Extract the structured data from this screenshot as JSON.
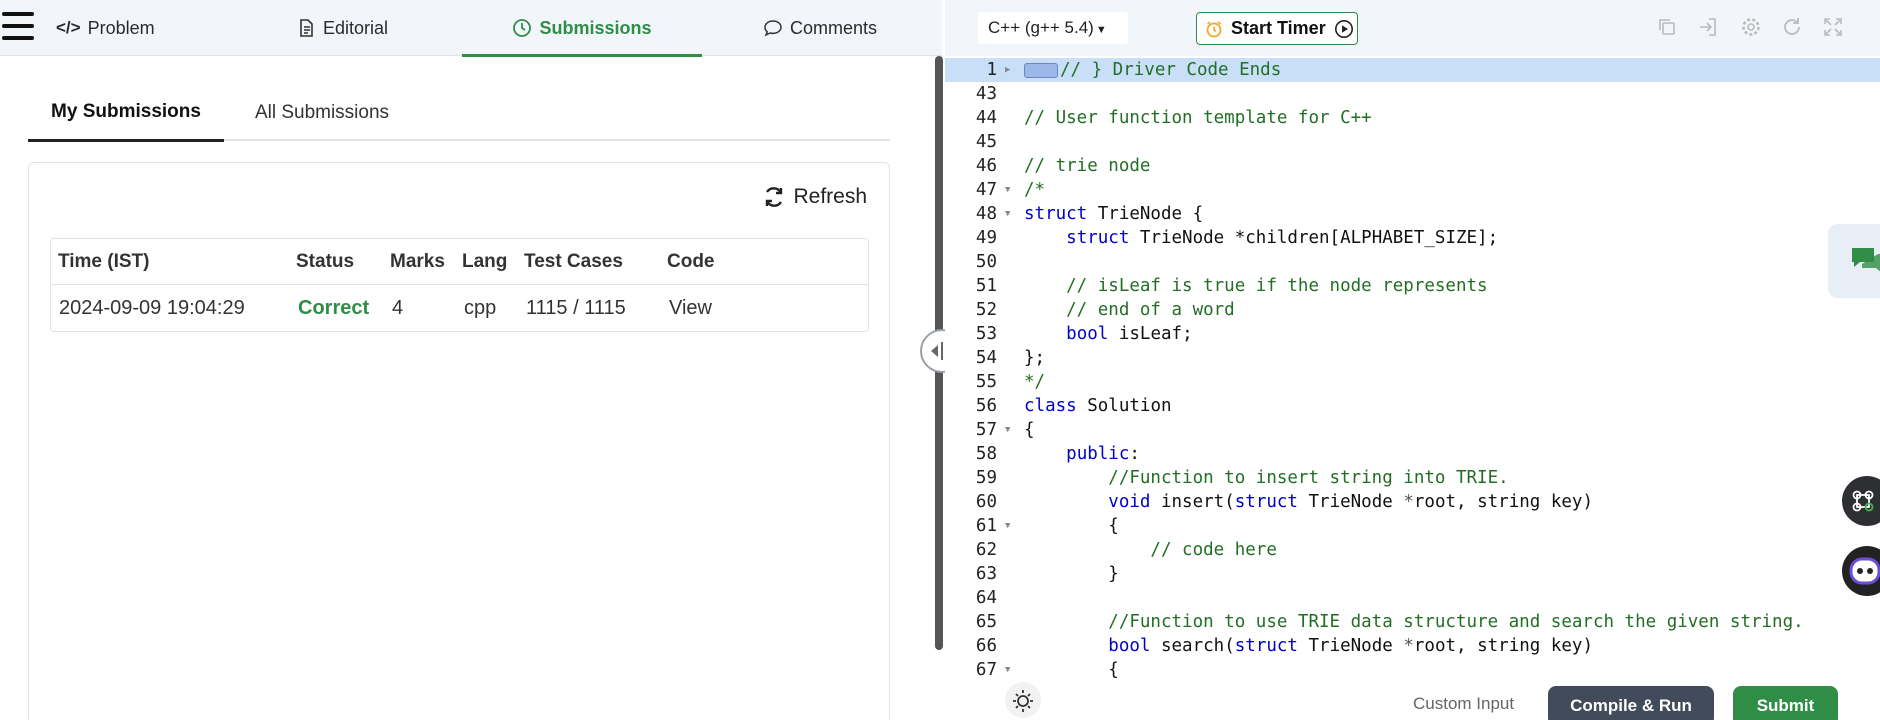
{
  "nav": {
    "tabs": [
      {
        "label": "Problem",
        "icon": "code-icon"
      },
      {
        "label": "Editorial",
        "icon": "document-icon"
      },
      {
        "label": "Submissions",
        "icon": "clock-icon"
      },
      {
        "label": "Comments",
        "icon": "comment-icon"
      }
    ],
    "active_tab": "Submissions"
  },
  "submissions": {
    "tabs": [
      "My Submissions",
      "All Submissions"
    ],
    "active_tab": "My Submissions",
    "refresh_label": "Refresh",
    "table": {
      "headers": [
        "Time (IST)",
        "Status",
        "Marks",
        "Lang",
        "Test Cases",
        "Code"
      ],
      "rows": [
        {
          "time": "2024-09-09 19:04:29",
          "status": "Correct",
          "marks": "4",
          "lang": "cpp",
          "test_cases": "1115 / 1115",
          "code": "View"
        }
      ]
    }
  },
  "editor": {
    "language": "C++ (g++ 5.4)",
    "timer_label": "Start Timer",
    "toolbar_icons": [
      "copy-icon",
      "sign-in-icon",
      "gear-icon",
      "reset-icon",
      "fullscreen-icon"
    ],
    "lines": [
      {
        "num": "1",
        "fold": "closed",
        "text": "// } Driver Code Ends",
        "highlight": true,
        "chip": true
      },
      {
        "num": "43",
        "text": ""
      },
      {
        "num": "44",
        "text": "// User function template for C++"
      },
      {
        "num": "45",
        "text": ""
      },
      {
        "num": "46",
        "text": "// trie node"
      },
      {
        "num": "47",
        "fold": "open",
        "text": "/*"
      },
      {
        "num": "48",
        "fold": "open",
        "text": "struct TrieNode {"
      },
      {
        "num": "49",
        "text": "    struct TrieNode *children[ALPHABET_SIZE];"
      },
      {
        "num": "50",
        "text": ""
      },
      {
        "num": "51",
        "text": "    // isLeaf is true if the node represents"
      },
      {
        "num": "52",
        "text": "    // end of a word"
      },
      {
        "num": "53",
        "text": "    bool isLeaf;"
      },
      {
        "num": "54",
        "text": "};"
      },
      {
        "num": "55",
        "text": "*/"
      },
      {
        "num": "56",
        "text": "class Solution"
      },
      {
        "num": "57",
        "fold": "open",
        "text": "{"
      },
      {
        "num": "58",
        "text": "    public:"
      },
      {
        "num": "59",
        "text": "        //Function to insert string into TRIE."
      },
      {
        "num": "60",
        "text": "        void insert(struct TrieNode *root, string key)"
      },
      {
        "num": "61",
        "fold": "open",
        "text": "        {"
      },
      {
        "num": "62",
        "text": "            // code here"
      },
      {
        "num": "63",
        "text": "        }"
      },
      {
        "num": "64",
        "text": ""
      },
      {
        "num": "65",
        "text": "        //Function to use TRIE data structure and search the given string."
      },
      {
        "num": "66",
        "text": "        bool search(struct TrieNode *root, string key)"
      },
      {
        "num": "67",
        "fold": "open",
        "text": "        {"
      }
    ]
  },
  "footer": {
    "custom_input_label": "Custom Input",
    "compile_label": "Compile & Run",
    "submit_label": "Submit"
  },
  "colors": {
    "accent": "#2f8d46",
    "comment": "#236e25",
    "keyword": "#0000cc",
    "compile_bg": "#414b59"
  }
}
